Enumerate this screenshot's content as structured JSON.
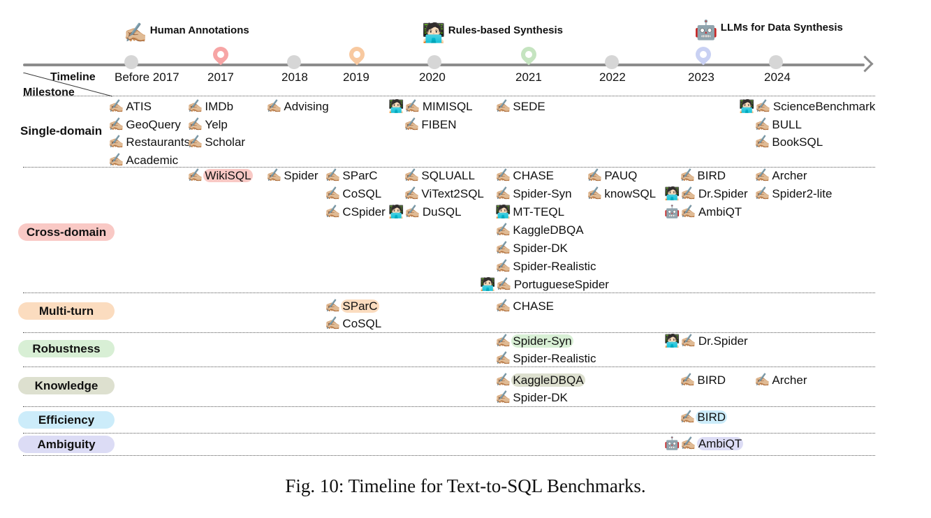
{
  "legend": [
    {
      "icon": "✍🏼",
      "icon_name": "writing-hand-icon",
      "label": "Human Annotations"
    },
    {
      "icon": "🧑🏻‍💻",
      "icon_name": "technologist-icon",
      "label": "Rules-based Synthesis"
    },
    {
      "icon": "🤖",
      "icon_name": "robot-icon",
      "label": "LLMs for Data Synthesis"
    }
  ],
  "timeline": {
    "corner_top": "Timeline",
    "corner_bottom": "Milestone",
    "years": [
      "Before 2017",
      "2017",
      "2018",
      "2019",
      "2020",
      "2021",
      "2022",
      "2023",
      "2024"
    ],
    "highlighted_years": {
      "2017": "#f7a5a5",
      "2019": "#f8c9a0",
      "2021": "#c5e4c0",
      "2023": "#c9d1f3"
    }
  },
  "categories": [
    {
      "key": "single",
      "label": "Single-domain",
      "pill": false
    },
    {
      "key": "cross",
      "label": "Cross-domain",
      "pill": true,
      "color": "#f9c9c5"
    },
    {
      "key": "multi",
      "label": "Multi-turn",
      "pill": true,
      "color": "#fbdcbf"
    },
    {
      "key": "robust",
      "label": "Robustness",
      "pill": true,
      "color": "#d8efd5"
    },
    {
      "key": "knowledge",
      "label": "Knowledge",
      "pill": true,
      "color": "#dde0cf"
    },
    {
      "key": "efficiency",
      "label": "Efficiency",
      "pill": true,
      "color": "#ccecfa"
    },
    {
      "key": "ambiguity",
      "label": "Ambiguity",
      "pill": true,
      "color": "#dcdcf5"
    }
  ],
  "entries": [
    {
      "cat": "single",
      "year": "Before 2017",
      "icons": [
        "writing-hand-icon"
      ],
      "name": "ATIS"
    },
    {
      "cat": "single",
      "year": "Before 2017",
      "icons": [
        "writing-hand-icon"
      ],
      "name": "GeoQuery"
    },
    {
      "cat": "single",
      "year": "Before 2017",
      "icons": [
        "writing-hand-icon"
      ],
      "name": "Restaurants"
    },
    {
      "cat": "single",
      "year": "Before 2017",
      "icons": [
        "writing-hand-icon"
      ],
      "name": "Academic"
    },
    {
      "cat": "single",
      "year": "2017",
      "icons": [
        "writing-hand-icon"
      ],
      "name": "IMDb"
    },
    {
      "cat": "single",
      "year": "2017",
      "icons": [
        "writing-hand-icon"
      ],
      "name": "Yelp"
    },
    {
      "cat": "single",
      "year": "2017",
      "icons": [
        "writing-hand-icon"
      ],
      "name": "Scholar"
    },
    {
      "cat": "single",
      "year": "2018",
      "icons": [
        "writing-hand-icon"
      ],
      "name": "Advising"
    },
    {
      "cat": "single",
      "year": "2020",
      "icons": [
        "technologist-icon",
        "writing-hand-icon"
      ],
      "name": "MIMISQL"
    },
    {
      "cat": "single",
      "year": "2020",
      "icons": [
        "writing-hand-icon"
      ],
      "name": "FIBEN"
    },
    {
      "cat": "single",
      "year": "2021",
      "icons": [
        "writing-hand-icon"
      ],
      "name": "SEDE"
    },
    {
      "cat": "single",
      "year": "2024",
      "icons": [
        "technologist-icon",
        "writing-hand-icon"
      ],
      "name": "ScienceBenchmark"
    },
    {
      "cat": "single",
      "year": "2024",
      "icons": [
        "writing-hand-icon"
      ],
      "name": "BULL"
    },
    {
      "cat": "single",
      "year": "2024",
      "icons": [
        "writing-hand-icon"
      ],
      "name": "BookSQL"
    },
    {
      "cat": "cross",
      "year": "2017",
      "icons": [
        "writing-hand-icon"
      ],
      "name": "WikiSQL",
      "highlight": "#f9c9c5"
    },
    {
      "cat": "cross",
      "year": "2018",
      "icons": [
        "writing-hand-icon"
      ],
      "name": "Spider"
    },
    {
      "cat": "cross",
      "year": "2019",
      "icons": [
        "writing-hand-icon"
      ],
      "name": "SParC"
    },
    {
      "cat": "cross",
      "year": "2019",
      "icons": [
        "writing-hand-icon"
      ],
      "name": "CoSQL"
    },
    {
      "cat": "cross",
      "year": "2019",
      "icons": [
        "writing-hand-icon"
      ],
      "name": "CSpider"
    },
    {
      "cat": "cross",
      "year": "2020",
      "icons": [
        "writing-hand-icon"
      ],
      "name": "SQLUALL"
    },
    {
      "cat": "cross",
      "year": "2020",
      "icons": [
        "writing-hand-icon"
      ],
      "name": "ViText2SQL"
    },
    {
      "cat": "cross",
      "year": "2020",
      "icons": [
        "technologist-icon",
        "writing-hand-icon"
      ],
      "name": "DuSQL"
    },
    {
      "cat": "cross",
      "year": "2021",
      "icons": [
        "writing-hand-icon"
      ],
      "name": "CHASE"
    },
    {
      "cat": "cross",
      "year": "2021",
      "icons": [
        "writing-hand-icon"
      ],
      "name": "Spider-Syn"
    },
    {
      "cat": "cross",
      "year": "2021",
      "icons": [
        "technologist-icon"
      ],
      "name": "MT-TEQL"
    },
    {
      "cat": "cross",
      "year": "2021",
      "icons": [
        "writing-hand-icon"
      ],
      "name": "KaggleDBQA"
    },
    {
      "cat": "cross",
      "year": "2021",
      "icons": [
        "writing-hand-icon"
      ],
      "name": "Spider-DK"
    },
    {
      "cat": "cross",
      "year": "2021",
      "icons": [
        "writing-hand-icon"
      ],
      "name": "Spider-Realistic"
    },
    {
      "cat": "cross",
      "year": "2021",
      "icons": [
        "technologist-icon",
        "writing-hand-icon"
      ],
      "name": "PortugueseSpider"
    },
    {
      "cat": "cross",
      "year": "2022",
      "icons": [
        "writing-hand-icon"
      ],
      "name": "PAUQ"
    },
    {
      "cat": "cross",
      "year": "2022",
      "icons": [
        "writing-hand-icon"
      ],
      "name": "knowSQL"
    },
    {
      "cat": "cross",
      "year": "2023",
      "icons": [
        "writing-hand-icon"
      ],
      "name": "BIRD"
    },
    {
      "cat": "cross",
      "year": "2023",
      "icons": [
        "technologist-icon",
        "writing-hand-icon"
      ],
      "name": "Dr.Spider"
    },
    {
      "cat": "cross",
      "year": "2023",
      "icons": [
        "robot-icon",
        "writing-hand-icon"
      ],
      "name": "AmbiQT"
    },
    {
      "cat": "cross",
      "year": "2024",
      "icons": [
        "writing-hand-icon"
      ],
      "name": "Archer"
    },
    {
      "cat": "cross",
      "year": "2024",
      "icons": [
        "writing-hand-icon"
      ],
      "name": "Spider2-lite"
    },
    {
      "cat": "multi",
      "year": "2019",
      "icons": [
        "writing-hand-icon"
      ],
      "name": "SParC",
      "highlight": "#fbdcbf"
    },
    {
      "cat": "multi",
      "year": "2019",
      "icons": [
        "writing-hand-icon"
      ],
      "name": "CoSQL"
    },
    {
      "cat": "multi",
      "year": "2021",
      "icons": [
        "writing-hand-icon"
      ],
      "name": "CHASE"
    },
    {
      "cat": "robust",
      "year": "2021",
      "icons": [
        "writing-hand-icon"
      ],
      "name": "Spider-Syn",
      "highlight": "#d8efd5"
    },
    {
      "cat": "robust",
      "year": "2021",
      "icons": [
        "writing-hand-icon"
      ],
      "name": "Spider-Realistic"
    },
    {
      "cat": "robust",
      "year": "2023",
      "icons": [
        "technologist-icon",
        "writing-hand-icon"
      ],
      "name": "Dr.Spider"
    },
    {
      "cat": "knowledge",
      "year": "2021",
      "icons": [
        "writing-hand-icon"
      ],
      "name": "KaggleDBQA",
      "highlight": "#dde0cf"
    },
    {
      "cat": "knowledge",
      "year": "2021",
      "icons": [
        "writing-hand-icon"
      ],
      "name": "Spider-DK"
    },
    {
      "cat": "knowledge",
      "year": "2023",
      "icons": [
        "writing-hand-icon"
      ],
      "name": "BIRD"
    },
    {
      "cat": "knowledge",
      "year": "2024",
      "icons": [
        "writing-hand-icon"
      ],
      "name": "Archer"
    },
    {
      "cat": "efficiency",
      "year": "2023",
      "icons": [
        "writing-hand-icon"
      ],
      "name": "BIRD",
      "highlight": "#ccecfa"
    },
    {
      "cat": "ambiguity",
      "year": "2023",
      "icons": [
        "robot-icon",
        "writing-hand-icon"
      ],
      "name": "AmbiQT",
      "highlight": "#dcdcf5"
    }
  ],
  "caption": "Fig. 10: Timeline for Text-to-SQL Benchmarks."
}
